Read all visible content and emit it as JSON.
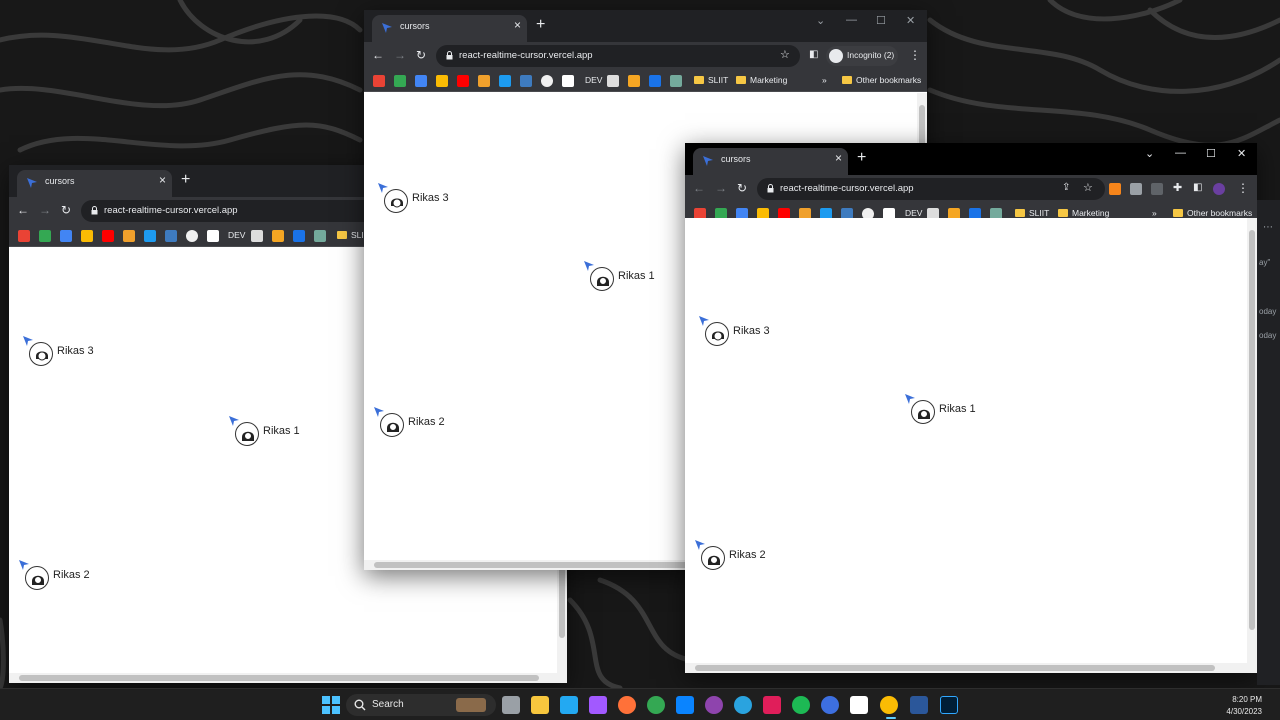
{
  "tab_title": "cursors",
  "url": "react-realtime-cursor.vercel.app",
  "incognito_label": "Incognito (2)",
  "bookmarks": {
    "dev": "DEV",
    "sliit": "SLIIT",
    "sliit_short": "SLI",
    "marketing": "Marketing",
    "more": "»",
    "other": "Other bookmarks"
  },
  "users": {
    "u1": "Rikas 1",
    "u2": "Rikas 2",
    "u3": "Rikas 3"
  },
  "taskbar": {
    "search_label": "Search",
    "time": "8:20 PM",
    "date": "4/30/2023"
  },
  "peek": {
    "frag1": "ay\"",
    "frag2": "oday",
    "frag3": "oday"
  },
  "colors": {
    "cursor_blue": "#3b6fd8",
    "chrome_dark": "#202124",
    "chrome_toolbar": "#35363a"
  }
}
